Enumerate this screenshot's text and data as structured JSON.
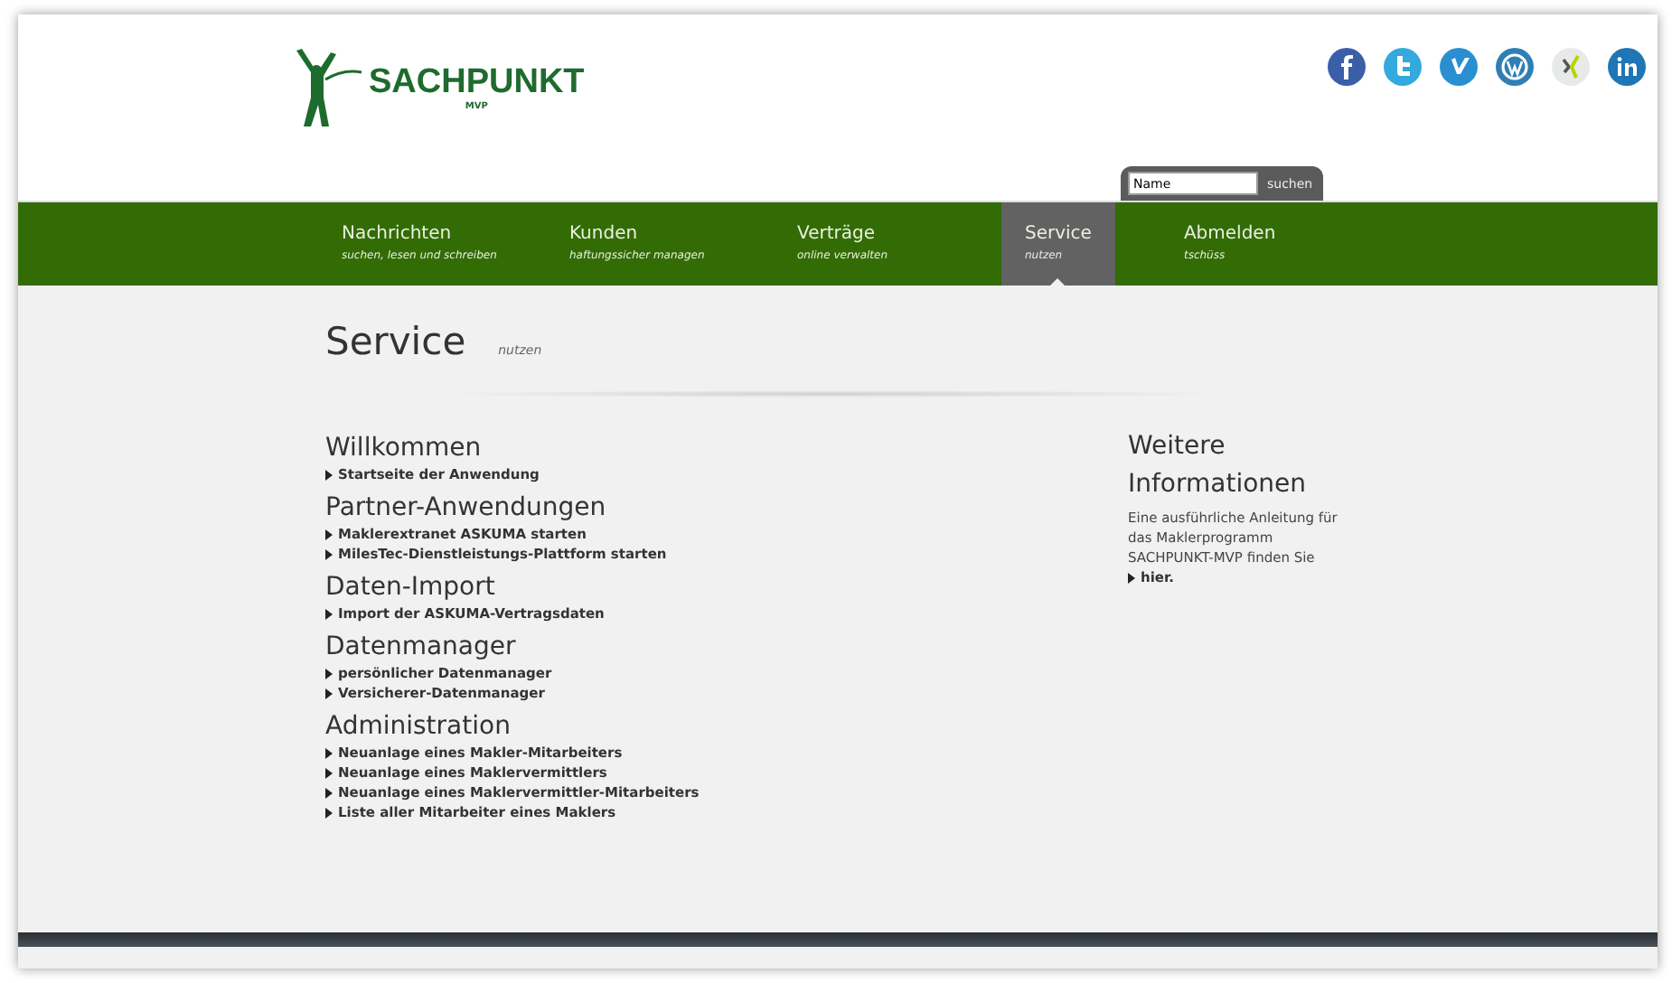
{
  "logo": {
    "name": "SACHPUNKT",
    "tagline": "MVP"
  },
  "social_icons": [
    {
      "kind": "f",
      "color": "#3b5ea8"
    },
    {
      "kind": "t",
      "color": "#33a9dd"
    },
    {
      "kind": "v",
      "color": "#2a8fd0"
    },
    {
      "kind": "w",
      "color": "#2f7fb5"
    },
    {
      "kind": "x",
      "color": "#e8eaea"
    },
    {
      "kind": "in",
      "color": "#1f76b5"
    }
  ],
  "search": {
    "value": "Name",
    "button": "suchen"
  },
  "nav": [
    {
      "label": "Nachrichten",
      "sub": "suchen, lesen und schreiben",
      "selected": false
    },
    {
      "label": "Kunden",
      "sub": "haftungssicher managen",
      "selected": false
    },
    {
      "label": "Verträge",
      "sub": "online verwalten",
      "selected": false
    },
    {
      "label": "Service",
      "sub": "nutzen",
      "selected": true
    },
    {
      "label": "Abmelden",
      "sub": "tschüss",
      "selected": false
    }
  ],
  "page": {
    "title": "Service",
    "subtitle": "nutzen"
  },
  "sections": [
    {
      "heading": "Willkommen",
      "links": [
        "Startseite der Anwendung"
      ]
    },
    {
      "heading": "Partner-Anwendungen",
      "links": [
        "Maklerextranet ASKUMA starten",
        "MilesTec-Dienstleistungs-Plattform starten"
      ]
    },
    {
      "heading": "Daten-Import",
      "links": [
        "Import der ASKUMA-Vertragsdaten"
      ]
    },
    {
      "heading": "Datenmanager",
      "links": [
        "persönlicher Datenmanager",
        "Versicherer-Datenmanager"
      ]
    },
    {
      "heading": "Administration",
      "links": [
        "Neuanlage eines Makler-Mitarbeiters",
        "Neuanlage eines Maklervermittlers",
        "Neuanlage eines Maklervermittler-Mitarbeiters",
        "Liste aller Mitarbeiter eines Maklers"
      ]
    }
  ],
  "aside": {
    "heading": "Weitere Informationen",
    "text": "Eine ausführliche Anleitung für das Maklerprogramm SACHPUNKT-MVP finden Sie",
    "link": "hier."
  }
}
